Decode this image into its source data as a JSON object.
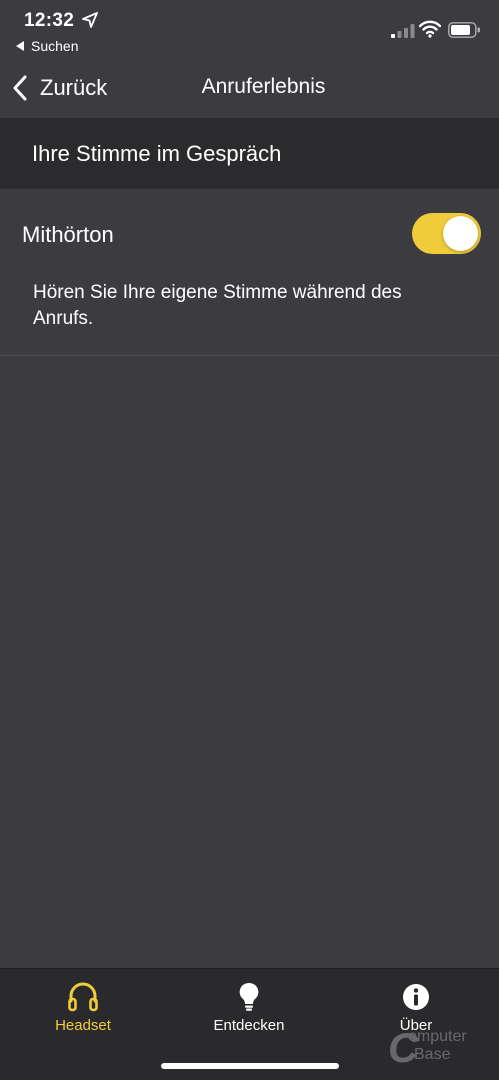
{
  "status_bar": {
    "time": "12:32",
    "back_app_label": "Suchen",
    "icons": [
      "location-arrow-icon",
      "cellular-signal-icon",
      "wifi-icon",
      "battery-icon"
    ]
  },
  "nav": {
    "back_label": "Zurück",
    "title": "Anruferlebnis"
  },
  "section": {
    "title": "Ihre Stimme im Gespräch"
  },
  "setting": {
    "label": "Mithörton",
    "enabled": true,
    "description": "Hören Sie Ihre eigene Stimme während des Anrufs."
  },
  "tabs": [
    {
      "label": "Headset",
      "icon": "headphones-icon",
      "active": true
    },
    {
      "label": "Entdecken",
      "icon": "lightbulb-icon",
      "active": false
    },
    {
      "label": "Über",
      "icon": "info-icon",
      "active": false
    }
  ],
  "watermark": {
    "line1": "omputer",
    "line2": "Base"
  },
  "colors": {
    "background": "#3c3c40",
    "header_background": "#2b2b2e",
    "tab_bar_background": "#2a2a2d",
    "accent": "#f0cc3a",
    "text": "#ffffff"
  }
}
